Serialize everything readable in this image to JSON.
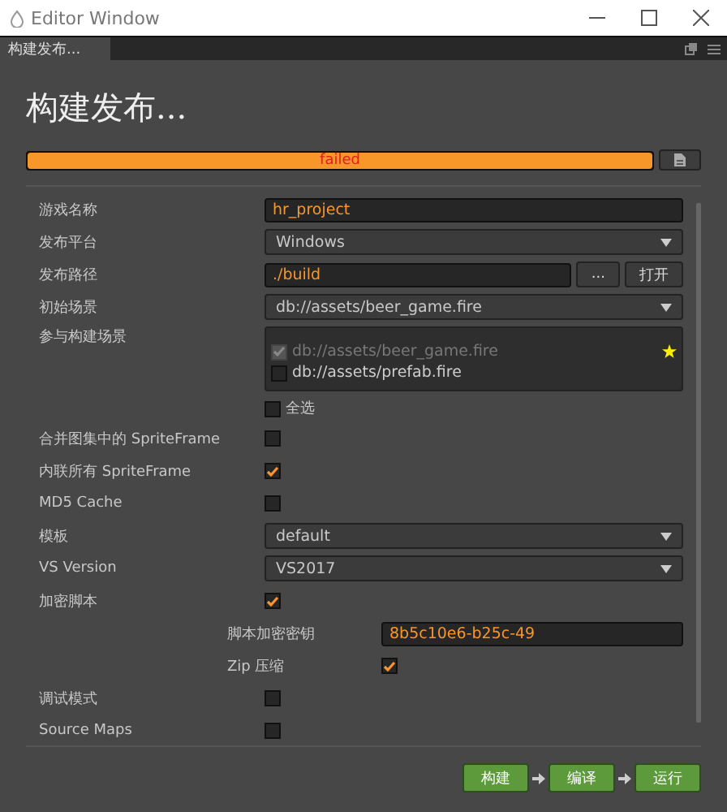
{
  "window": {
    "title": "Editor Window"
  },
  "tabs": [
    {
      "label": "构建发布...",
      "selected": true
    }
  ],
  "heading": "构建发布...",
  "progress": {
    "level": 1,
    "status": "failed"
  },
  "rows": [
    {
      "kind": "input",
      "label": "游戏名称",
      "value": "hr_project"
    },
    {
      "kind": "select",
      "label": "发布平台",
      "value": "Windows"
    },
    {
      "kind": "path",
      "label": "发布路径",
      "value": "./build",
      "buttons": [
        "...",
        "打开"
      ]
    },
    {
      "kind": "select",
      "label": "初始场景",
      "value": "db://assets/beer_game.fire"
    },
    {
      "kind": "scenes",
      "label": "参与构建场景",
      "items": [
        {
          "path": "db://assets/beer_game.fire",
          "checked": true,
          "disabled": true,
          "starred": true
        },
        {
          "path": "db://assets/prefab.fire",
          "checked": false,
          "disabled": false,
          "starred": false
        }
      ],
      "select_all": {
        "label": "全选",
        "checked": false
      }
    },
    {
      "kind": "checkbox",
      "label": "合并图集中的 SpriteFrame",
      "checked": false
    },
    {
      "kind": "checkbox",
      "label": "内联所有 SpriteFrame",
      "checked": true
    },
    {
      "kind": "checkbox",
      "label": "MD5 Cache",
      "checked": false
    },
    {
      "kind": "select",
      "label": "模板",
      "value": "default"
    },
    {
      "kind": "select",
      "label": "VS Version",
      "value": "VS2017"
    },
    {
      "kind": "checkbox",
      "label": "加密脚本",
      "checked": true,
      "children": [
        {
          "kind": "input",
          "label": "脚本加密密钥",
          "value": "8b5c10e6-b25c-49"
        },
        {
          "kind": "checkbox",
          "label": "Zip 压缩",
          "checked": true
        }
      ]
    },
    {
      "kind": "checkbox",
      "label": "调试模式",
      "checked": false
    },
    {
      "kind": "checkbox",
      "label": "Source Maps",
      "checked": false
    }
  ],
  "actions": [
    "构建",
    "编译",
    "运行"
  ]
}
